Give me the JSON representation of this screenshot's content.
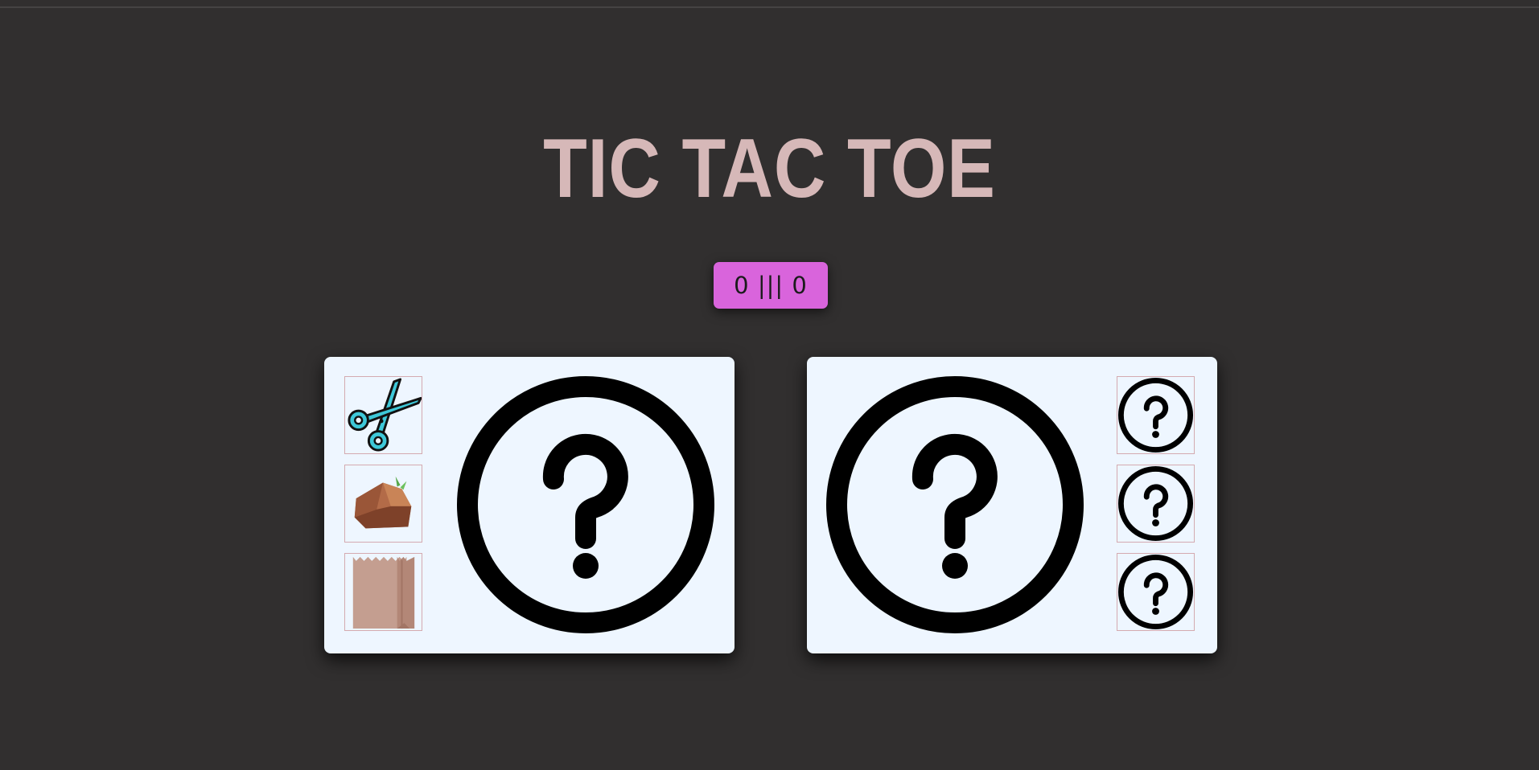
{
  "title": "TIC TAC TOE",
  "score": {
    "player": "0",
    "separator": "|||",
    "computer": "0",
    "background_color": "#d964dc"
  },
  "player_panel": {
    "choices": [
      {
        "name": "scissors",
        "icon": "scissors-icon"
      },
      {
        "name": "rock",
        "icon": "rock-icon"
      },
      {
        "name": "paper",
        "icon": "paper-bag-icon"
      }
    ],
    "selected_icon": "question-circle-icon"
  },
  "computer_panel": {
    "choices": [
      {
        "icon": "question-circle-icon"
      },
      {
        "icon": "question-circle-icon"
      },
      {
        "icon": "question-circle-icon"
      }
    ],
    "selected_icon": "question-circle-icon"
  },
  "colors": {
    "background": "#312f2f",
    "title": "#d6b8b8",
    "panel": "#eef6ff",
    "choice_border": "#d4aab0"
  }
}
